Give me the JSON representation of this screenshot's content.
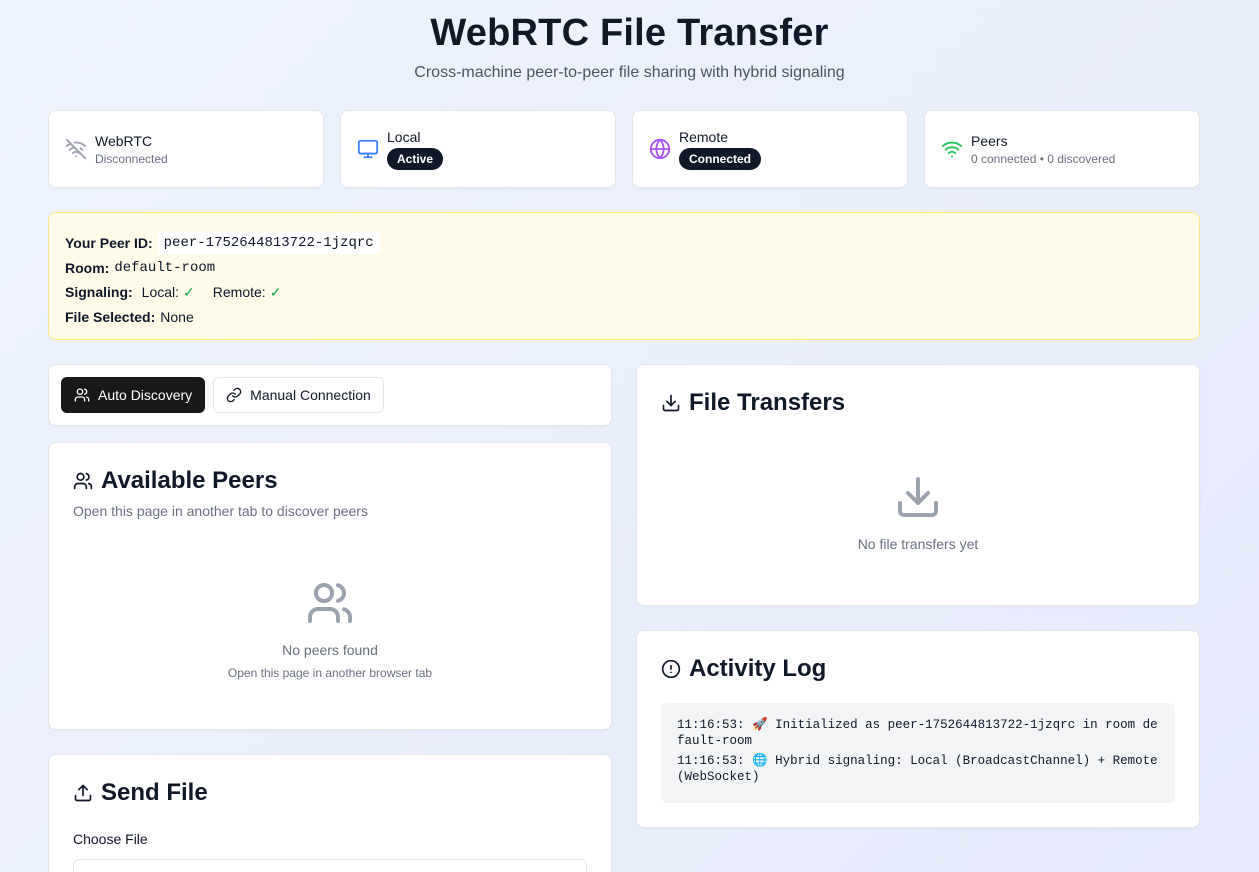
{
  "header": {
    "title": "WebRTC File Transfer",
    "subtitle": "Cross-machine peer-to-peer file sharing with hybrid signaling"
  },
  "status": {
    "webrtc": {
      "title": "WebRTC",
      "value": "Disconnected",
      "icon": "wifi-off-icon"
    },
    "local": {
      "title": "Local",
      "badge": "Active",
      "icon": "monitor-icon"
    },
    "remote": {
      "title": "Remote",
      "badge": "Connected",
      "icon": "globe-icon"
    },
    "peers": {
      "title": "Peers",
      "value": "0 connected • 0 discovered",
      "icon": "wifi-icon"
    }
  },
  "info": {
    "peer_id_label": "Your Peer ID:",
    "peer_id": "peer-1752644813722-1jzqrc",
    "room_label": "Room:",
    "room": "default-room",
    "signaling_label": "Signaling:",
    "local_label": "Local:",
    "remote_label": "Remote:",
    "check": "✓",
    "file_label": "File Selected:",
    "file": "None"
  },
  "tabs": {
    "auto": "Auto Discovery",
    "manual": "Manual Connection"
  },
  "peers": {
    "title": "Available Peers",
    "subtitle": "Open this page in another tab to discover peers",
    "empty_title": "No peers found",
    "empty_sub": "Open this page in another browser tab"
  },
  "send": {
    "title": "Send File",
    "choose_label": "Choose File"
  },
  "transfers": {
    "title": "File Transfers",
    "empty": "No file transfers yet"
  },
  "log": {
    "title": "Activity Log",
    "entries": [
      "11:16:53: 🚀 Initialized as peer-1752644813722-1jzqrc in room default-room",
      "11:16:53: 🌐 Hybrid signaling: Local (BroadcastChannel) + Remote (WebSocket)"
    ]
  },
  "colors": {
    "dark": "#18181b",
    "local_icon": "#3b82f6",
    "remote_icon": "#a855f7",
    "peers_icon": "#22c55e",
    "check": "#16a34a",
    "info_bg": "#fefce8"
  }
}
